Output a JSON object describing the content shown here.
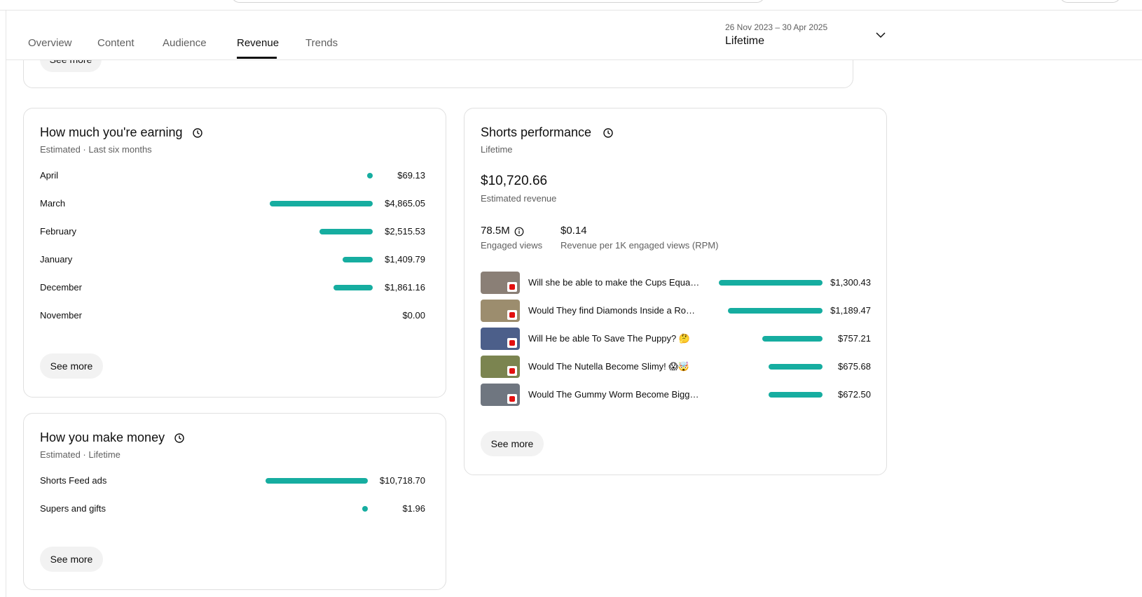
{
  "tabs": [
    "Overview",
    "Content",
    "Audience",
    "Revenue",
    "Trends"
  ],
  "active_tab": "Revenue",
  "date_range": "26 Nov 2023 – 30 Apr 2025",
  "date_label": "Lifetime",
  "prev_card": {
    "see_more": "See more"
  },
  "earning": {
    "title": "How much you're earning",
    "subtitle": "Estimated · Last six months",
    "rows": [
      {
        "label": "April",
        "value": "$69.13",
        "amount": 69.13
      },
      {
        "label": "March",
        "value": "$4,865.05",
        "amount": 4865.05
      },
      {
        "label": "February",
        "value": "$2,515.53",
        "amount": 2515.53
      },
      {
        "label": "January",
        "value": "$1,409.79",
        "amount": 1409.79
      },
      {
        "label": "December",
        "value": "$1,861.16",
        "amount": 1861.16
      },
      {
        "label": "November",
        "value": "$0.00",
        "amount": 0
      }
    ],
    "see_more": "See more"
  },
  "make_money": {
    "title": "How you make money",
    "subtitle": "Estimated · Lifetime",
    "rows": [
      {
        "label": "Shorts Feed ads",
        "value": "$10,718.70",
        "amount": 10718.7
      },
      {
        "label": "Supers and gifts",
        "value": "$1.96",
        "amount": 1.96
      }
    ],
    "see_more": "See more"
  },
  "shorts": {
    "title": "Shorts performance",
    "subtitle": "Lifetime",
    "revenue": "$10,720.66",
    "revenue_label": "Estimated revenue",
    "views": "78.5M",
    "views_label": "Engaged views",
    "rpm": "$0.14",
    "rpm_label": "Revenue per 1K engaged views (RPM)",
    "videos": [
      {
        "title": "Will she be able to make the Cups Equa…",
        "value": "$1,300.43",
        "amount": 1300.43,
        "thumb_color": "#8a7f76"
      },
      {
        "title": "Would They find Diamonds Inside a Ro…",
        "value": "$1,189.47",
        "amount": 1189.47,
        "thumb_color": "#9c8d6e"
      },
      {
        "title": "Will He be able To Save The Puppy? 🤔",
        "value": "$757.21",
        "amount": 757.21,
        "thumb_color": "#4c5f8a"
      },
      {
        "title": "Would The Nutella Become Slimy! 😱🤯",
        "value": "$675.68",
        "amount": 675.68,
        "thumb_color": "#7b8450"
      },
      {
        "title": "Would The Gummy Worm Become Bigg…",
        "value": "$672.50",
        "amount": 672.5,
        "thumb_color": "#6f7680"
      }
    ],
    "see_more": "See more"
  },
  "colors": {
    "bar": "#16ada0",
    "text": "#0f0f0f",
    "secondary": "#606060"
  }
}
